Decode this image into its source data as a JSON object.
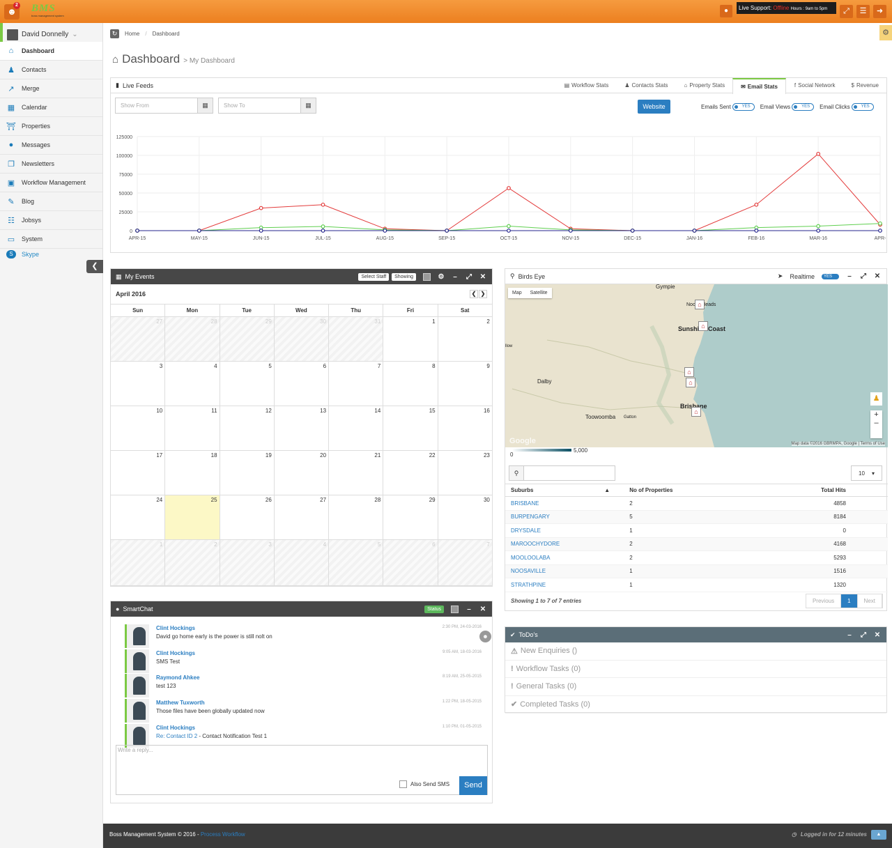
{
  "topbar": {
    "notif_count": "2",
    "logo_text": "BMS",
    "logo_sub": "boss management system",
    "live_support_label": "Live Support:",
    "live_support_status": "Offline",
    "live_support_hours": "Hours : 9am to 5pm"
  },
  "sidebar": {
    "user_name": "David Donnelly",
    "items": [
      {
        "label": "Dashboard",
        "icon": "home-icon"
      },
      {
        "label": "Contacts",
        "icon": "users-icon"
      },
      {
        "label": "Merge",
        "icon": "external-link-icon"
      },
      {
        "label": "Calendar",
        "icon": "calendar-icon"
      },
      {
        "label": "Properties",
        "icon": "bank-icon"
      },
      {
        "label": "Messages",
        "icon": "comment-icon"
      },
      {
        "label": "Newsletters",
        "icon": "copy-icon"
      },
      {
        "label": "Workflow Management",
        "icon": "briefcase-icon"
      },
      {
        "label": "Blog",
        "icon": "edit-icon"
      },
      {
        "label": "Jobsys",
        "icon": "sitemap-icon"
      },
      {
        "label": "System",
        "icon": "laptop-icon"
      }
    ],
    "skype": "Skype"
  },
  "breadcrumb": {
    "home": "Home",
    "current": "Dashboard"
  },
  "page": {
    "title": "Dashboard",
    "subtitle": "> My Dashboard"
  },
  "live": {
    "title": "Live Feeds",
    "tabs": [
      "Workflow Stats",
      "Contacts Stats",
      "Property Stats",
      "Email Stats",
      "Social Network",
      "Revenue"
    ],
    "active_tab": "Email Stats",
    "show_from": "Show From",
    "show_to": "Show To",
    "website_btn": "Website",
    "toggles": [
      {
        "label": "Emails Sent",
        "value": "YES"
      },
      {
        "label": "Email Views",
        "value": "YES"
      },
      {
        "label": "Email Clicks",
        "value": "YES"
      }
    ]
  },
  "chart_data": {
    "type": "line",
    "categories": [
      "APR-15",
      "MAY-15",
      "JUN-15",
      "JUL-15",
      "AUG-15",
      "SEP-15",
      "OCT-15",
      "NOV-15",
      "DEC-15",
      "JAN-16",
      "FEB-16",
      "MAR-16",
      "APR-"
    ],
    "ylim": [
      0,
      125000
    ],
    "yticks": [
      "125000",
      "100000",
      "75000",
      "50000",
      "25000",
      "0"
    ],
    "grid": true,
    "series": [
      {
        "name": "Emails Sent",
        "color": "#e33b3b",
        "values": [
          0,
          0,
          30000,
          34500,
          2500,
          0,
          56500,
          2500,
          0,
          0,
          34500,
          102000,
          8000
        ]
      },
      {
        "name": "Email Views",
        "color": "#5fcf4f",
        "values": [
          0,
          0,
          4000,
          5500,
          1000,
          0,
          6000,
          1000,
          0,
          0,
          4000,
          6000,
          9500
        ]
      },
      {
        "name": "Email Clicks",
        "color": "#24248c",
        "values": [
          0,
          0,
          0,
          0,
          0,
          0,
          0,
          0,
          0,
          0,
          0,
          0,
          0
        ]
      }
    ]
  },
  "events": {
    "title": "My Events",
    "select_staff": "Select Staff",
    "showing": "Showing",
    "month": "April 2016",
    "dow": [
      "Sun",
      "Mon",
      "Tue",
      "Wed",
      "Thu",
      "Fri",
      "Sat"
    ],
    "days": [
      "27",
      "28",
      "29",
      "30",
      "31",
      "1",
      "2",
      "3",
      "4",
      "5",
      "6",
      "7",
      "8",
      "9",
      "10",
      "11",
      "12",
      "13",
      "14",
      "15",
      "16",
      "17",
      "18",
      "19",
      "20",
      "21",
      "22",
      "23",
      "24",
      "25",
      "26",
      "27",
      "28",
      "29",
      "30",
      "1",
      "2",
      "3",
      "4",
      "5",
      "6",
      "7"
    ]
  },
  "birds": {
    "title": "Birds Eye",
    "realtime": "Realtime",
    "realtime_value": "YES",
    "map_btn": "Map",
    "satellite_btn": "Satellite",
    "places": [
      "Gympie",
      "Noosa Heads",
      "Sunshine Coast",
      "Dalby",
      "Brisbane",
      "Toowoomba",
      "Gatton",
      "llow"
    ],
    "attr": "Map data ©2016 GBRMPA, Google | Terms of Use",
    "google": "Google",
    "legend_min": "0",
    "legend_max": "5,000",
    "page_len": "10",
    "columns": [
      "Suburbs",
      "No of Properties",
      "Total Hits"
    ],
    "rows": [
      [
        "BRISBANE",
        "2",
        "4858"
      ],
      [
        "BURPENGARY",
        "5",
        "8184"
      ],
      [
        "DRYSDALE",
        "1",
        "0"
      ],
      [
        "MAROOCHYDORE",
        "2",
        "4168"
      ],
      [
        "MOOLOOLABA",
        "2",
        "5293"
      ],
      [
        "NOOSAVILLE",
        "1",
        "1516"
      ],
      [
        "STRATHPINE",
        "1",
        "1320"
      ]
    ],
    "info": "Showing 1 to 7 of 7 entries",
    "prev": "Previous",
    "page": "1",
    "next": "Next"
  },
  "todos": {
    "title": "ToDo's",
    "items": [
      {
        "label": "New Enquiries ()",
        "icon": "warning-icon"
      },
      {
        "label": "Workflow Tasks (0)",
        "icon": "exclamation-icon"
      },
      {
        "label": "General Tasks (0)",
        "icon": "exclamation-icon"
      },
      {
        "label": "Completed Tasks (0)",
        "icon": "check-icon"
      }
    ]
  },
  "chat": {
    "title": "SmartChat",
    "status_btn": "Status",
    "messages": [
      {
        "name": "Clint Hockings",
        "text": "David go home early is the power is still nolt on",
        "link": "",
        "time": "2:30 PM, 24-03-2016"
      },
      {
        "name": "Clint Hockings",
        "text": "SMS Test",
        "link": "",
        "time": "9:05 AM, 18-03-2016"
      },
      {
        "name": "Raymond Ahkee",
        "text": "test 123",
        "link": "",
        "time": "8:19 AM, 25-05-2015"
      },
      {
        "name": "Matthew Tuxworth",
        "text": "Those files have been globally updated now",
        "link": "",
        "time": "1:22 PM, 18-05-2015"
      },
      {
        "name": "Clint Hockings",
        "text": " - Contact Notification Test 1",
        "link": "Re: Contact ID 2",
        "time": "1:10 PM, 01-05-2015"
      }
    ],
    "reply_placeholder": "Write a reply...",
    "sms_label": "Also Send SMS",
    "send": "Send"
  },
  "footer": {
    "copy": "Boss Management System © 2016 - ",
    "link": "Process Workflow",
    "logged": "Logged in for 12 minutes"
  }
}
